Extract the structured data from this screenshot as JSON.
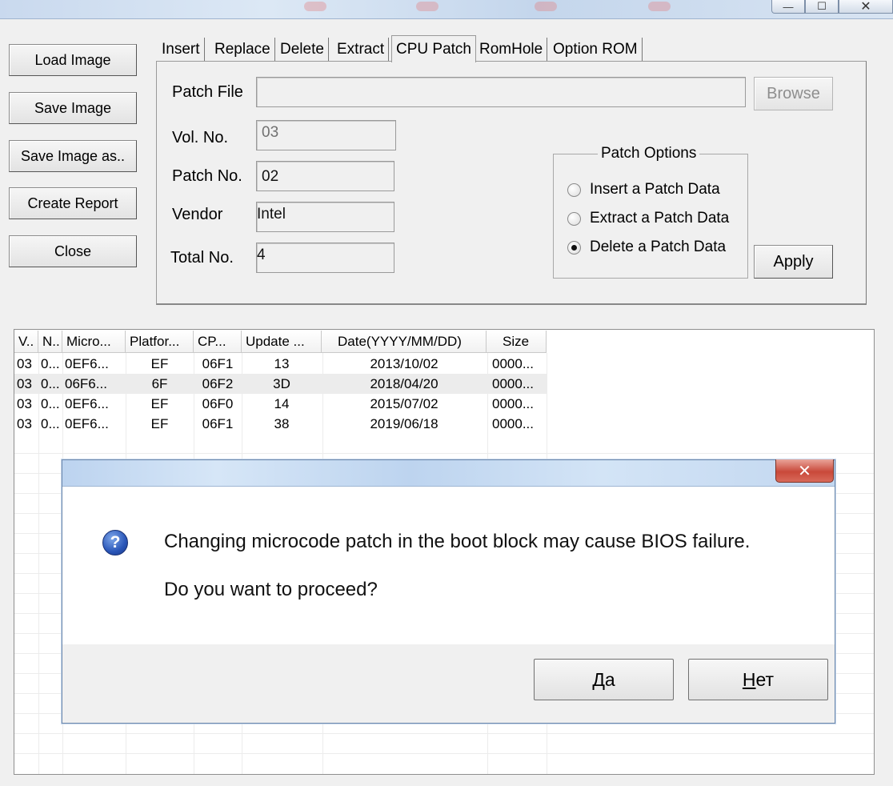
{
  "window": {
    "min_glyph": "—",
    "max_glyph": "☐",
    "close_glyph": "✕"
  },
  "left_buttons": [
    "Load Image",
    "Save Image",
    "Save Image as..",
    "Create Report",
    "Close"
  ],
  "tabs": [
    {
      "label": "Insert",
      "active": false
    },
    {
      "label": "Replace",
      "active": false
    },
    {
      "label": "Delete",
      "active": false
    },
    {
      "label": "Extract",
      "active": false
    },
    {
      "label": "CPU Patch",
      "active": true
    },
    {
      "label": "RomHole",
      "active": false
    },
    {
      "label": "Option ROM",
      "active": false
    }
  ],
  "cpu_patch": {
    "patch_file_label": "Patch File",
    "patch_file_value": "",
    "browse_label": "Browse",
    "vol_label": "Vol. No.",
    "vol_value": "03",
    "patch_no_label": "Patch No.",
    "patch_no_value": "02",
    "vendor_label": "Vendor",
    "vendor_value": "Intel",
    "total_label": "Total No.",
    "total_value": "4",
    "options_title": "Patch Options",
    "options": [
      {
        "label": "Insert a Patch Data",
        "checked": false
      },
      {
        "label": "Extract a Patch Data",
        "checked": false
      },
      {
        "label": "Delete a Patch Data",
        "checked": true
      }
    ],
    "apply_label": "Apply"
  },
  "table": {
    "columns": [
      "V..",
      "N..",
      "Micro...",
      "Platfor...",
      "CP...",
      "Update ...",
      "Date(YYYY/MM/DD)",
      "Size"
    ],
    "rows": [
      [
        "03",
        "0...",
        "0EF6...",
        "EF",
        "06F1",
        "13",
        "2013/10/02",
        "0000..."
      ],
      [
        "03",
        "0...",
        "06F6...",
        "6F",
        "06F2",
        "3D",
        "2018/04/20",
        "0000..."
      ],
      [
        "03",
        "0...",
        "0EF6...",
        "EF",
        "06F0",
        "14",
        "2015/07/02",
        "0000..."
      ],
      [
        "03",
        "0...",
        "0EF6...",
        "EF",
        "06F1",
        "38",
        "2019/06/18",
        "0000..."
      ]
    ]
  },
  "dialog": {
    "close_glyph": "✕",
    "icon_glyph": "?",
    "message": "Changing microcode patch in the boot block may cause BIOS failure.",
    "question": "Do you want to proceed?",
    "yes_accel": "Д",
    "yes_rest": "а",
    "no_accel": "Н",
    "no_rest": "ет"
  }
}
